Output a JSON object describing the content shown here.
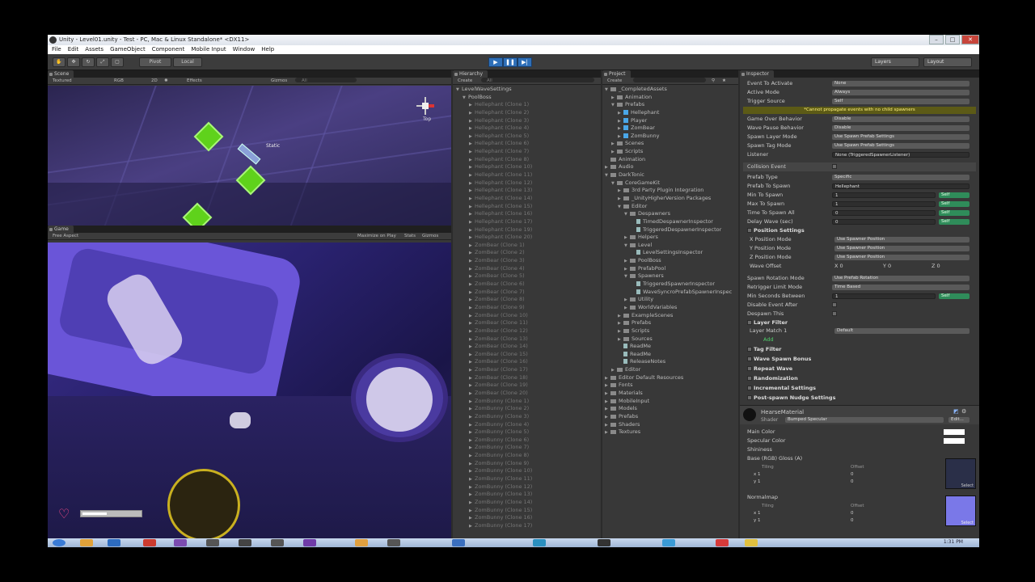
{
  "window": {
    "title": "Unity - Level01.unity - Test - PC, Mac & Linux Standalone* <DX11>"
  },
  "menu": [
    "File",
    "Edit",
    "Assets",
    "GameObject",
    "Component",
    "Mobile Input",
    "Window",
    "Help"
  ],
  "toolbar": {
    "pivot": "Pivot",
    "local": "Local",
    "layers": "Layers",
    "layout": "Layout"
  },
  "scene": {
    "tab": "Scene",
    "render_mode": "Textured",
    "color_mode": "RGB",
    "mode2d": "2D",
    "effects": "Effects",
    "gizmos": "Gizmos",
    "search": "All",
    "gizmo_label": "Top",
    "static_label": "Static"
  },
  "game": {
    "tab": "Game",
    "aspect": "Free Aspect",
    "maximize": "Maximize on Play",
    "stats": "Stats",
    "gizmos": "Gizmos"
  },
  "hierarchy": {
    "tab": "Hierarchy",
    "create": "Create",
    "search": "All",
    "items": [
      {
        "label": "LevelWaveSettings",
        "dim": false,
        "indent": 0,
        "arrow": "▼"
      },
      {
        "label": "PoolBoss",
        "dim": false,
        "indent": 1,
        "arrow": "▼"
      },
      {
        "label": "Hellephant (Clone 1)",
        "dim": true,
        "indent": 2,
        "arrow": "▶"
      },
      {
        "label": "Hellephant (Clone 2)",
        "dim": true,
        "indent": 2,
        "arrow": "▶"
      },
      {
        "label": "Hellephant (Clone 3)",
        "dim": true,
        "indent": 2,
        "arrow": "▶"
      },
      {
        "label": "Hellephant (Clone 4)",
        "dim": true,
        "indent": 2,
        "arrow": "▶"
      },
      {
        "label": "Hellephant (Clone 5)",
        "dim": true,
        "indent": 2,
        "arrow": "▶"
      },
      {
        "label": "Hellephant (Clone 6)",
        "dim": true,
        "indent": 2,
        "arrow": "▶"
      },
      {
        "label": "Hellephant (Clone 7)",
        "dim": true,
        "indent": 2,
        "arrow": "▶"
      },
      {
        "label": "Hellephant (Clone 8)",
        "dim": true,
        "indent": 2,
        "arrow": "▶"
      },
      {
        "label": "Hellephant (Clone 10)",
        "dim": true,
        "indent": 2,
        "arrow": "▶"
      },
      {
        "label": "Hellephant (Clone 11)",
        "dim": true,
        "indent": 2,
        "arrow": "▶"
      },
      {
        "label": "Hellephant (Clone 12)",
        "dim": true,
        "indent": 2,
        "arrow": "▶"
      },
      {
        "label": "Hellephant (Clone 13)",
        "dim": true,
        "indent": 2,
        "arrow": "▶"
      },
      {
        "label": "Hellephant (Clone 14)",
        "dim": true,
        "indent": 2,
        "arrow": "▶"
      },
      {
        "label": "Hellephant (Clone 15)",
        "dim": true,
        "indent": 2,
        "arrow": "▶"
      },
      {
        "label": "Hellephant (Clone 16)",
        "dim": true,
        "indent": 2,
        "arrow": "▶"
      },
      {
        "label": "Hellephant (Clone 17)",
        "dim": true,
        "indent": 2,
        "arrow": "▶"
      },
      {
        "label": "Hellephant (Clone 19)",
        "dim": true,
        "indent": 2,
        "arrow": "▶"
      },
      {
        "label": "Hellephant (Clone 20)",
        "dim": true,
        "indent": 2,
        "arrow": "▶"
      },
      {
        "label": "ZomBear (Clone 1)",
        "dim": true,
        "indent": 2,
        "arrow": "▶"
      },
      {
        "label": "ZomBear (Clone 2)",
        "dim": true,
        "indent": 2,
        "arrow": "▶"
      },
      {
        "label": "ZomBear (Clone 3)",
        "dim": true,
        "indent": 2,
        "arrow": "▶"
      },
      {
        "label": "ZomBear (Clone 4)",
        "dim": true,
        "indent": 2,
        "arrow": "▶"
      },
      {
        "label": "ZomBear (Clone 5)",
        "dim": true,
        "indent": 2,
        "arrow": "▶"
      },
      {
        "label": "ZomBear (Clone 6)",
        "dim": true,
        "indent": 2,
        "arrow": "▶"
      },
      {
        "label": "ZomBear (Clone 7)",
        "dim": true,
        "indent": 2,
        "arrow": "▶"
      },
      {
        "label": "ZomBear (Clone 8)",
        "dim": true,
        "indent": 2,
        "arrow": "▶"
      },
      {
        "label": "ZomBear (Clone 9)",
        "dim": true,
        "indent": 2,
        "arrow": "▶"
      },
      {
        "label": "ZomBear (Clone 10)",
        "dim": true,
        "indent": 2,
        "arrow": "▶"
      },
      {
        "label": "ZomBear (Clone 11)",
        "dim": true,
        "indent": 2,
        "arrow": "▶"
      },
      {
        "label": "ZomBear (Clone 12)",
        "dim": true,
        "indent": 2,
        "arrow": "▶"
      },
      {
        "label": "ZomBear (Clone 13)",
        "dim": true,
        "indent": 2,
        "arrow": "▶"
      },
      {
        "label": "ZomBear (Clone 14)",
        "dim": true,
        "indent": 2,
        "arrow": "▶"
      },
      {
        "label": "ZomBear (Clone 15)",
        "dim": true,
        "indent": 2,
        "arrow": "▶"
      },
      {
        "label": "ZomBear (Clone 16)",
        "dim": true,
        "indent": 2,
        "arrow": "▶"
      },
      {
        "label": "ZomBear (Clone 17)",
        "dim": true,
        "indent": 2,
        "arrow": "▶"
      },
      {
        "label": "ZomBear (Clone 18)",
        "dim": true,
        "indent": 2,
        "arrow": "▶"
      },
      {
        "label": "ZomBear (Clone 19)",
        "dim": true,
        "indent": 2,
        "arrow": "▶"
      },
      {
        "label": "ZomBear (Clone 20)",
        "dim": true,
        "indent": 2,
        "arrow": "▶"
      },
      {
        "label": "ZomBunny (Clone 1)",
        "dim": true,
        "indent": 2,
        "arrow": "▶"
      },
      {
        "label": "ZomBunny (Clone 2)",
        "dim": true,
        "indent": 2,
        "arrow": "▶"
      },
      {
        "label": "ZomBunny (Clone 3)",
        "dim": true,
        "indent": 2,
        "arrow": "▶"
      },
      {
        "label": "ZomBunny (Clone 4)",
        "dim": true,
        "indent": 2,
        "arrow": "▶"
      },
      {
        "label": "ZomBunny (Clone 5)",
        "dim": true,
        "indent": 2,
        "arrow": "▶"
      },
      {
        "label": "ZomBunny (Clone 6)",
        "dim": true,
        "indent": 2,
        "arrow": "▶"
      },
      {
        "label": "ZomBunny (Clone 7)",
        "dim": true,
        "indent": 2,
        "arrow": "▶"
      },
      {
        "label": "ZomBunny (Clone 8)",
        "dim": true,
        "indent": 2,
        "arrow": "▶"
      },
      {
        "label": "ZomBunny (Clone 9)",
        "dim": true,
        "indent": 2,
        "arrow": "▶"
      },
      {
        "label": "ZomBunny (Clone 10)",
        "dim": true,
        "indent": 2,
        "arrow": "▶"
      },
      {
        "label": "ZomBunny (Clone 11)",
        "dim": true,
        "indent": 2,
        "arrow": "▶"
      },
      {
        "label": "ZomBunny (Clone 12)",
        "dim": true,
        "indent": 2,
        "arrow": "▶"
      },
      {
        "label": "ZomBunny (Clone 13)",
        "dim": true,
        "indent": 2,
        "arrow": "▶"
      },
      {
        "label": "ZomBunny (Clone 14)",
        "dim": true,
        "indent": 2,
        "arrow": "▶"
      },
      {
        "label": "ZomBunny (Clone 15)",
        "dim": true,
        "indent": 2,
        "arrow": "▶"
      },
      {
        "label": "ZomBunny (Clone 16)",
        "dim": true,
        "indent": 2,
        "arrow": "▶"
      },
      {
        "label": "ZomBunny (Clone 17)",
        "dim": true,
        "indent": 2,
        "arrow": "▶"
      }
    ]
  },
  "project": {
    "tab": "Project",
    "create": "Create",
    "items": [
      {
        "label": "_CompletedAssets",
        "indent": 0,
        "icon": "folder",
        "arrow": "▼"
      },
      {
        "label": "Animation",
        "indent": 1,
        "icon": "folder",
        "arrow": "▶"
      },
      {
        "label": "Prefabs",
        "indent": 1,
        "icon": "folder",
        "arrow": "▼"
      },
      {
        "label": "Hellephant",
        "indent": 2,
        "icon": "prefab",
        "arrow": "▶"
      },
      {
        "label": "Player",
        "indent": 2,
        "icon": "prefab",
        "arrow": "▶"
      },
      {
        "label": "ZomBear",
        "indent": 2,
        "icon": "prefab",
        "arrow": "▶"
      },
      {
        "label": "ZomBunny",
        "indent": 2,
        "icon": "prefab",
        "arrow": "▶"
      },
      {
        "label": "Scenes",
        "indent": 1,
        "icon": "folder",
        "arrow": "▶"
      },
      {
        "label": "Scripts",
        "indent": 1,
        "icon": "folder",
        "arrow": "▶"
      },
      {
        "label": "Animation",
        "indent": 0,
        "icon": "folder",
        "arrow": ""
      },
      {
        "label": "Audio",
        "indent": 0,
        "icon": "folder",
        "arrow": "▶"
      },
      {
        "label": "DarkTonic",
        "indent": 0,
        "icon": "folder",
        "arrow": "▼"
      },
      {
        "label": "CoreGameKit",
        "indent": 1,
        "icon": "folder",
        "arrow": "▼"
      },
      {
        "label": "3rd Party Plugin Integration",
        "indent": 2,
        "icon": "folder",
        "arrow": "▶"
      },
      {
        "label": "_UnityHigherVersion Packages",
        "indent": 2,
        "icon": "folder",
        "arrow": "▶"
      },
      {
        "label": "Editor",
        "indent": 2,
        "icon": "folder",
        "arrow": "▼"
      },
      {
        "label": "Despawners",
        "indent": 3,
        "icon": "folder",
        "arrow": "▼"
      },
      {
        "label": "TimedDespawnerInspector",
        "indent": 4,
        "icon": "script",
        "arrow": ""
      },
      {
        "label": "TriggeredDespawnerInspector",
        "indent": 4,
        "icon": "script",
        "arrow": ""
      },
      {
        "label": "Helpers",
        "indent": 3,
        "icon": "folder",
        "arrow": "▶"
      },
      {
        "label": "Level",
        "indent": 3,
        "icon": "folder",
        "arrow": "▼"
      },
      {
        "label": "LevelSettingsInspector",
        "indent": 4,
        "icon": "script",
        "arrow": ""
      },
      {
        "label": "PoolBoss",
        "indent": 3,
        "icon": "folder",
        "arrow": "▶"
      },
      {
        "label": "PrefabPool",
        "indent": 3,
        "icon": "folder",
        "arrow": "▶"
      },
      {
        "label": "Spawners",
        "indent": 3,
        "icon": "folder",
        "arrow": "▼"
      },
      {
        "label": "TriggeredSpawnerInspector",
        "indent": 4,
        "icon": "script",
        "arrow": ""
      },
      {
        "label": "WaveSyncroPrefabSpawnerInspec",
        "indent": 4,
        "icon": "script",
        "arrow": ""
      },
      {
        "label": "Utility",
        "indent": 3,
        "icon": "folder",
        "arrow": "▶"
      },
      {
        "label": "WorldVariables",
        "indent": 3,
        "icon": "folder",
        "arrow": "▶"
      },
      {
        "label": "ExampleScenes",
        "indent": 2,
        "icon": "folder",
        "arrow": "▶"
      },
      {
        "label": "Prefabs",
        "indent": 2,
        "icon": "folder",
        "arrow": "▶"
      },
      {
        "label": "Scripts",
        "indent": 2,
        "icon": "folder",
        "arrow": "▶"
      },
      {
        "label": "Sources",
        "indent": 2,
        "icon": "folder",
        "arrow": "▶"
      },
      {
        "label": "ReadMe",
        "indent": 2,
        "icon": "script",
        "arrow": ""
      },
      {
        "label": "ReadMe",
        "indent": 2,
        "icon": "script",
        "arrow": ""
      },
      {
        "label": "ReleaseNotes",
        "indent": 2,
        "icon": "script",
        "arrow": ""
      },
      {
        "label": "Editor",
        "indent": 1,
        "icon": "folder",
        "arrow": "▶"
      },
      {
        "label": "Editor Default Resources",
        "indent": 0,
        "icon": "folder",
        "arrow": "▶"
      },
      {
        "label": "Fonts",
        "indent": 0,
        "icon": "folder",
        "arrow": "▶"
      },
      {
        "label": "Materials",
        "indent": 0,
        "icon": "folder",
        "arrow": "▶"
      },
      {
        "label": "MobileInput",
        "indent": 0,
        "icon": "folder",
        "arrow": "▶"
      },
      {
        "label": "Models",
        "indent": 0,
        "icon": "folder",
        "arrow": "▶"
      },
      {
        "label": "Prefabs",
        "indent": 0,
        "icon": "folder",
        "arrow": "▶"
      },
      {
        "label": "Shaders",
        "indent": 0,
        "icon": "folder",
        "arrow": "▶"
      },
      {
        "label": "Textures",
        "indent": 0,
        "icon": "folder",
        "arrow": "▶"
      }
    ]
  },
  "inspector": {
    "tab": "Inspector",
    "event_to_activate": {
      "label": "Event To Activate",
      "value": "None"
    },
    "active_mode": {
      "label": "Active Mode",
      "value": "Always"
    },
    "trigger_source": {
      "label": "Trigger Source",
      "value": "Self"
    },
    "warning": "*Cannot propagate events with no child spawners",
    "game_over": {
      "label": "Game Over Behavior",
      "value": "Disable"
    },
    "wave_pause": {
      "label": "Wave Pause Behavior",
      "value": "Disable"
    },
    "spawn_layer": {
      "label": "Spawn Layer Mode",
      "value": "Use Spawn Prefab Settings"
    },
    "spawn_tag": {
      "label": "Spawn Tag Mode",
      "value": "Use Spawn Prefab Settings"
    },
    "listener": {
      "label": "Listener",
      "value": "None (TriggeredSpawnerListener)"
    },
    "collision_event": "Collision Event",
    "prefab_type": {
      "label": "Prefab Type",
      "value": "Specific"
    },
    "prefab_to_spawn": {
      "label": "Prefab To Spawn",
      "value": "Hellephant"
    },
    "min_to_spawn": {
      "label": "Min To Spawn",
      "value": "1",
      "self": "Self"
    },
    "max_to_spawn": {
      "label": "Max To Spawn",
      "value": "1",
      "self": "Self"
    },
    "time_to_spawn_all": {
      "label": "Time To Spawn All",
      "value": "0",
      "self": "Self"
    },
    "delay_wave": {
      "label": "Delay Wave (sec)",
      "value": "0",
      "self": "Self"
    },
    "position_settings": "Position Settings",
    "x_pos": {
      "label": "X Position Mode",
      "value": "Use Spawner Position"
    },
    "y_pos": {
      "label": "Y Position Mode",
      "value": "Use Spawner Position"
    },
    "z_pos": {
      "label": "Z Position Mode",
      "value": "Use Spawner Position"
    },
    "wave_offset": {
      "label": "Wave Offset",
      "x": "X  0",
      "y": "Y  0",
      "z": "Z  0"
    },
    "spawn_rotation": {
      "label": "Spawn Rotation Mode",
      "value": "Use Prefab Rotation"
    },
    "retrigger": {
      "label": "Retrigger Limit Mode",
      "value": "Time Based"
    },
    "min_seconds": {
      "label": "Min Seconds Between",
      "value": "1",
      "self": "Self"
    },
    "disable_event_after": "Disable Event After",
    "despawn_this": "Despawn This",
    "layer_filter": "Layer Filter",
    "layer_match": {
      "label": "Layer Match 1",
      "value": "Default"
    },
    "add": "Add",
    "tag_filter": "Tag Filter",
    "wave_spawn_bonus": "Wave Spawn Bonus",
    "repeat_wave": "Repeat Wave",
    "randomization": "Randomization",
    "incremental": "Incremental Settings",
    "post_spawn": "Post-spawn Nudge Settings",
    "material": {
      "name": "HearseMaterial",
      "shader_label": "Shader",
      "shader": "Bumped Specular",
      "edit": "Edit..."
    },
    "main_color": "Main Color",
    "specular_color": "Specular Color",
    "shininess": "Shininess",
    "base_tex": "Base (RGB) Gloss (A)",
    "tiling": "Tiling",
    "offset": "Offset",
    "tile_x": "x  1",
    "tile_y": "y  1",
    "off_x": "0",
    "off_y": "0",
    "normalmap": "Normalmap",
    "select": "Select"
  },
  "taskbar": {
    "time": "1:31 PM"
  }
}
